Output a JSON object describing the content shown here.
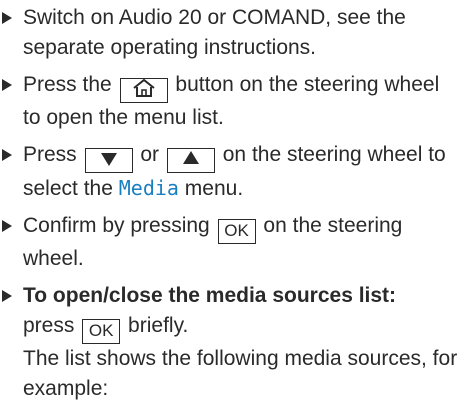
{
  "steps": [
    {
      "text": "Switch on Audio 20 or COMAND, see the separate operating instructions."
    },
    {
      "before": "Press the",
      "key_icon": "home-icon",
      "after": "button on the steering wheel to open the menu list."
    },
    {
      "before": "Press",
      "key1_icon": "arrow-down-icon",
      "mid": "or",
      "key2_icon": "arrow-up-icon",
      "after1": "on the steering wheel to select the",
      "menu_name": "Media",
      "after2": "menu."
    },
    {
      "before": "Confirm by pressing",
      "key_label": "OK",
      "after": "on the steering wheel."
    },
    {
      "heading": "To open/close the media sources list:",
      "before": "press",
      "key_label": "OK",
      "after": "briefly.",
      "note": "The list shows the following media sources, for example:"
    }
  ],
  "colors": {
    "text": "#2a2a2a",
    "menu_highlight": "#1a7fc1"
  }
}
